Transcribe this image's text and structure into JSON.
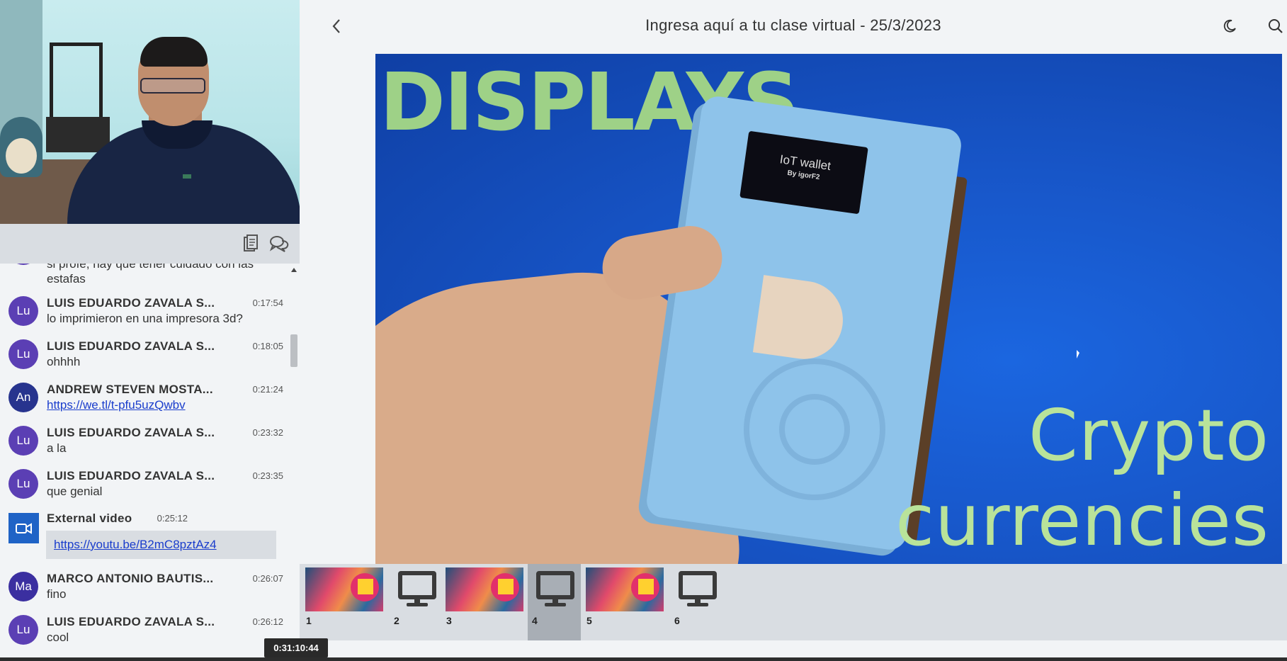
{
  "header": {
    "title": "Ingresa aquí a tu clase virtual - 25/3/2023",
    "back_icon": "chevron-left-icon",
    "theme_icon": "moon-icon",
    "search_icon": "search-icon"
  },
  "webcam": {
    "label": ""
  },
  "chat_toolbar": {
    "notes_icon": "clipboard-icon",
    "chat_icon": "chat-bubbles-icon"
  },
  "chat": {
    "partial_message": "si profe, hay que tener cuidado con las estafas",
    "messages": [
      {
        "initials": "Lu",
        "sender": "LUIS EDUARDO ZAVALA S...",
        "time": "0:17:54",
        "text": "lo imprimieron en una impresora 3d?"
      },
      {
        "initials": "Lu",
        "sender": "LUIS EDUARDO ZAVALA S...",
        "time": "0:18:05",
        "text": "ohhhh"
      },
      {
        "initials": "An",
        "sender": "ANDREW STEVEN MOSTA...",
        "time": "0:21:24",
        "text": "https://we.tl/t-pfu5uzQwbv"
      },
      {
        "initials": "Lu",
        "sender": "LUIS EDUARDO ZAVALA S...",
        "time": "0:23:32",
        "text": "a la"
      },
      {
        "initials": "Lu",
        "sender": "LUIS EDUARDO ZAVALA S...",
        "time": "0:23:35",
        "text": "que genial"
      }
    ],
    "external_video": {
      "label": "External video",
      "time": "0:25:12",
      "url": "https://youtu.be/B2mC8pztAz4"
    },
    "messages_after": [
      {
        "initials": "Ma",
        "sender": "MARCO ANTONIO BAUTIS...",
        "time": "0:26:07",
        "text": "fino"
      },
      {
        "initials": "Lu",
        "sender": "LUIS EDUARDO ZAVALA S...",
        "time": "0:26:12",
        "text": "cool"
      }
    ]
  },
  "slide": {
    "heading": "DISPLAYS",
    "oled_line1": "IoT wallet",
    "oled_line2": "By igorF2",
    "text_line1": "Crypto",
    "text_line2": "currencies"
  },
  "thumbnails": [
    {
      "number": "1",
      "kind": "image"
    },
    {
      "number": "2",
      "kind": "screen"
    },
    {
      "number": "3",
      "kind": "image"
    },
    {
      "number": "4",
      "kind": "screen",
      "active": true
    },
    {
      "number": "5",
      "kind": "image"
    },
    {
      "number": "6",
      "kind": "screen"
    }
  ],
  "playback": {
    "tooltip_time": "0:31:10:44",
    "current_time": "0:31:10",
    "tooltip_suffix": ":44"
  },
  "colors": {
    "accent_blue": "#1f63c6",
    "avatar_purple": "#5b3fb4",
    "avatar_navy": "#27348e",
    "link": "#1a3dcc"
  }
}
